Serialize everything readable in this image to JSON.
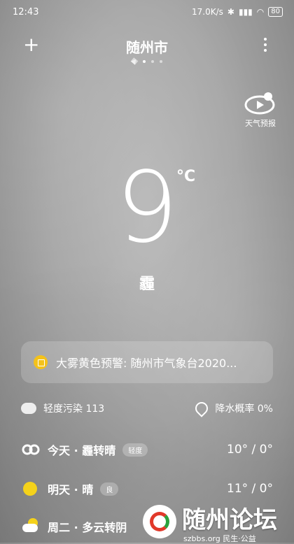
{
  "status": {
    "time": "12:43",
    "speed": "17.0K/s",
    "battery": "80"
  },
  "header": {
    "city": "随州市"
  },
  "forecast_button": {
    "label": "天气预报"
  },
  "current": {
    "temp": "9",
    "unit": "°C",
    "condition": "霾"
  },
  "alert": {
    "text": "大雾黄色预警: 随州市气象台2020..."
  },
  "info": {
    "aqi": "轻度污染 113",
    "precip": "降水概率 0%"
  },
  "days": [
    {
      "label": "今天 · 霾转晴",
      "chip": "轻度",
      "temps": "10° / 0°",
      "icon": "haze-icon"
    },
    {
      "label": "明天 · 晴",
      "chip": "良",
      "temps": "11° / 0°",
      "icon": "sun-icon"
    },
    {
      "label": "周二 · 多云转阴",
      "chip": "",
      "temps": "",
      "icon": "partly-cloudy-icon"
    }
  ],
  "watermark": {
    "title": "随州论坛",
    "sub": "szbbs.org 民生·公益"
  },
  "colors": {
    "accent_sun": "#f5d21a",
    "alert_badge": "#f4c21a"
  }
}
